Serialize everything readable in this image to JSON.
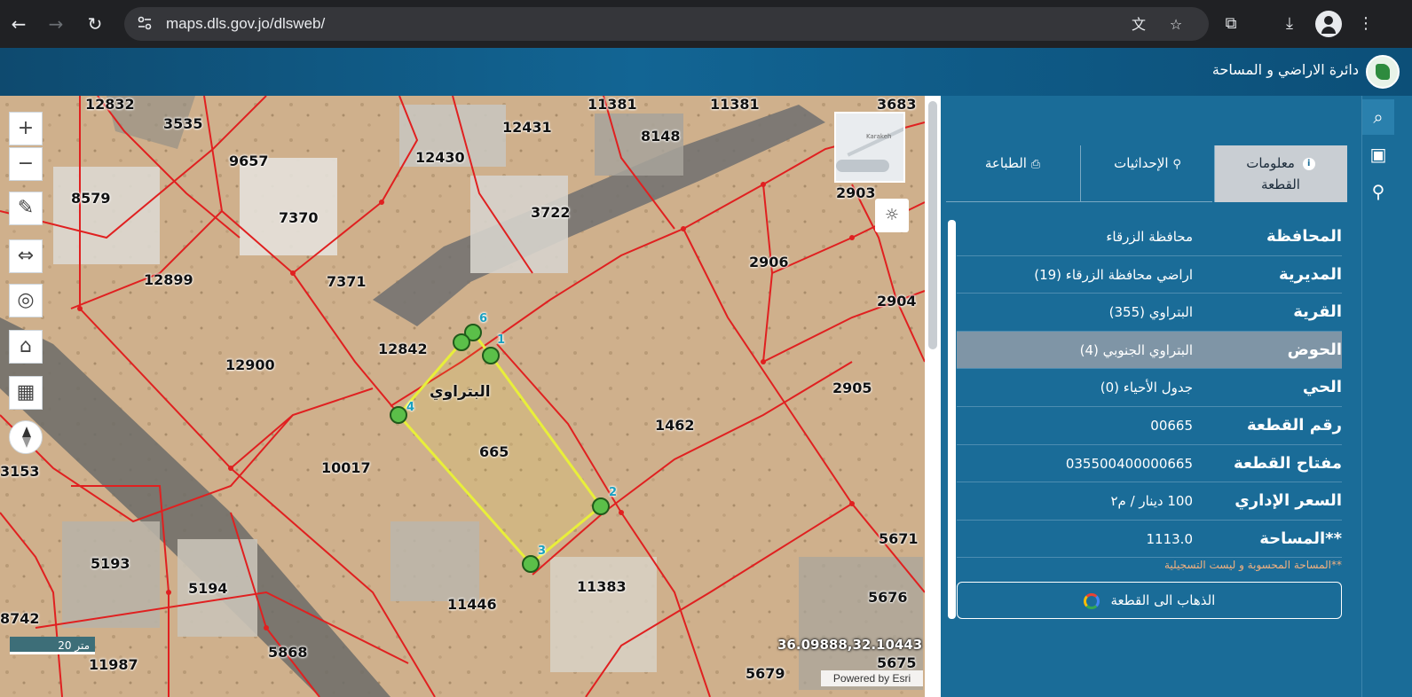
{
  "browser": {
    "url": "maps.dls.gov.jo/dlsweb/"
  },
  "header": {
    "title": "دائرة الاراضي و المساحة"
  },
  "map": {
    "parcels": [
      "12832",
      "3535",
      "11381",
      "11381",
      "3683",
      "12431",
      "8148",
      "12430",
      "9657",
      "8579",
      "7370",
      "3722",
      "2903",
      "12899",
      "7371",
      "2906",
      "2904",
      "12842",
      "12900",
      "2905",
      "1462",
      "665",
      "10017",
      "3153",
      "5193",
      "5194",
      "11383",
      "11446",
      "5671",
      "5676",
      "8742",
      "5868",
      "11987",
      "5679",
      "5675"
    ],
    "village_label": "البتراوي",
    "vertex_labels": [
      "1",
      "2",
      "3",
      "4",
      "6"
    ],
    "scale_label": "20 متر",
    "coordinates": "36.09888,32.10443",
    "attribution": "Powered by Esri",
    "overview_text": "Karakeh"
  },
  "panel": {
    "tabs": [
      {
        "label": "معلومات القطعة",
        "icon": "info-icon"
      },
      {
        "label": "الإحداثيات",
        "icon": "person-pin-icon"
      },
      {
        "label": "الطباعة",
        "icon": "print-icon"
      }
    ],
    "rows": [
      {
        "key": "المحافظة",
        "value": "محافظة الزرقاء"
      },
      {
        "key": "المديرية",
        "value": "اراضي محافظة الزرقاء (19)"
      },
      {
        "key": "القرية",
        "value": "البتراوي (355)"
      },
      {
        "key": "الحوض",
        "value": "البتراوي الجنوبي (4)"
      },
      {
        "key": "الحي",
        "value": "جدول الأحياء (0)"
      },
      {
        "key": "رقم القطعة",
        "value": "00665"
      },
      {
        "key": "مفتاح القطعة",
        "value": "035500400000665"
      },
      {
        "key": "السعر الإداري",
        "value": "100 دينار / م٢"
      },
      {
        "key": "**المساحة",
        "value": "1113.0"
      }
    ],
    "note": "**المساحة المحسوبة و ليست التسجيلية",
    "goto_button": "الذهاب الى القطعة"
  },
  "colors": {
    "header_bg": "#126594",
    "panel_bg": "#1a6c98",
    "parcel_line": "#e02020",
    "selected_parcel": "#e8ef3a",
    "vertex": "#4caf50"
  }
}
